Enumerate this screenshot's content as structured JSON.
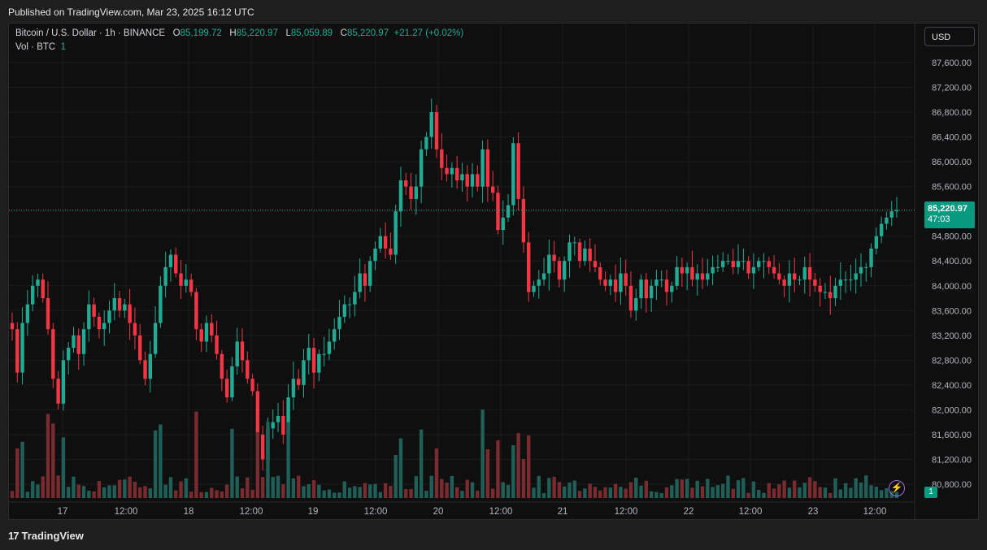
{
  "header": {
    "published": "Published on TradingView.com, Mar 23, 2025 16:12 UTC"
  },
  "legend": {
    "symbol": "Bitcoin / U.S. Dollar · 1h · BINANCE",
    "o_label": "O",
    "o_value": "85,199.72",
    "h_label": "H",
    "h_value": "85,220.97",
    "l_label": "L",
    "l_value": "85,059.89",
    "c_label": "C",
    "c_value": "85,220.97",
    "change": "+21.27 (+0.02%)",
    "vol_label": "Vol · BTC",
    "vol_value": "1"
  },
  "currency_button": "USD",
  "last_price": {
    "price": "85,220.97",
    "countdown": "47:03"
  },
  "volume_tag": "1",
  "footer": {
    "brand": "TradingView"
  },
  "colors": {
    "up": "#22ab94",
    "down": "#f23645",
    "up_vol": "#1f5f57",
    "down_vol": "#7a2b2f",
    "bg": "#0f0f0f"
  },
  "chart_data": {
    "type": "candlestick",
    "y_ticks": [
      "87,600.00",
      "87,200.00",
      "86,800.00",
      "86,400.00",
      "86,000.00",
      "85,600.00",
      "85,200.00",
      "84,800.00",
      "84,400.00",
      "84,000.00",
      "83,600.00",
      "83,200.00",
      "82,800.00",
      "82,400.00",
      "82,000.00",
      "81,600.00",
      "81,200.00",
      "80,800.00"
    ],
    "ylim": [
      80700,
      87900
    ],
    "x_labels": [
      "17",
      "12:00",
      "18",
      "12:00",
      "19",
      "12:00",
      "20",
      "12:00",
      "21",
      "12:00",
      "22",
      "12:00",
      "23",
      "12:00"
    ],
    "last_price": 85220.97,
    "series": [
      {
        "name": "candles",
        "closes": [
          83300,
          82600,
          83400,
          83700,
          84000,
          84100,
          83800,
          83300,
          82500,
          82100,
          82800,
          83000,
          83200,
          82900,
          83300,
          83700,
          83500,
          83300,
          83400,
          83600,
          83800,
          83600,
          83700,
          83400,
          83200,
          82800,
          82500,
          82900,
          83400,
          84000,
          84300,
          84500,
          84200,
          84000,
          84100,
          83900,
          83300,
          83100,
          83400,
          83200,
          82900,
          82500,
          82200,
          82700,
          83100,
          82800,
          82500,
          82300,
          81600,
          81200,
          81700,
          81800,
          81900,
          81600,
          82200,
          82500,
          82400,
          82800,
          83000,
          82600,
          82900,
          82900,
          83100,
          83300,
          83500,
          83700,
          83700,
          83900,
          84200,
          84000,
          84400,
          84600,
          84800,
          84600,
          84500,
          85200,
          85700,
          85600,
          85400,
          85600,
          86200,
          86400,
          86800,
          86200,
          85900,
          85800,
          85900,
          85700,
          85800,
          85600,
          85800,
          85600,
          86200,
          85600,
          85500,
          84900,
          85100,
          85300,
          86300,
          85400,
          84700,
          83900,
          84000,
          84100,
          84200,
          84500,
          84400,
          84100,
          84400,
          84700,
          84700,
          84400,
          84600,
          84400,
          84300,
          84100,
          84000,
          84100,
          83900,
          84200,
          84000,
          83600,
          83800,
          84100,
          83800,
          84000,
          84100,
          84100,
          83900,
          84000,
          84300,
          84200,
          84300,
          84100,
          84200,
          84100,
          84200,
          84300,
          84300,
          84400,
          84400,
          84300,
          84400,
          84400,
          84200,
          84300,
          84400,
          84400,
          84300,
          84200,
          84100,
          84000,
          84200,
          84100,
          84100,
          84300,
          84100,
          84000,
          83900,
          83900,
          83800,
          84000,
          84100,
          84100,
          84100,
          84200,
          84300,
          84300,
          84600,
          84800,
          85000,
          85100,
          85200,
          85220.97
        ]
      }
    ],
    "volume_max_label": "1"
  }
}
